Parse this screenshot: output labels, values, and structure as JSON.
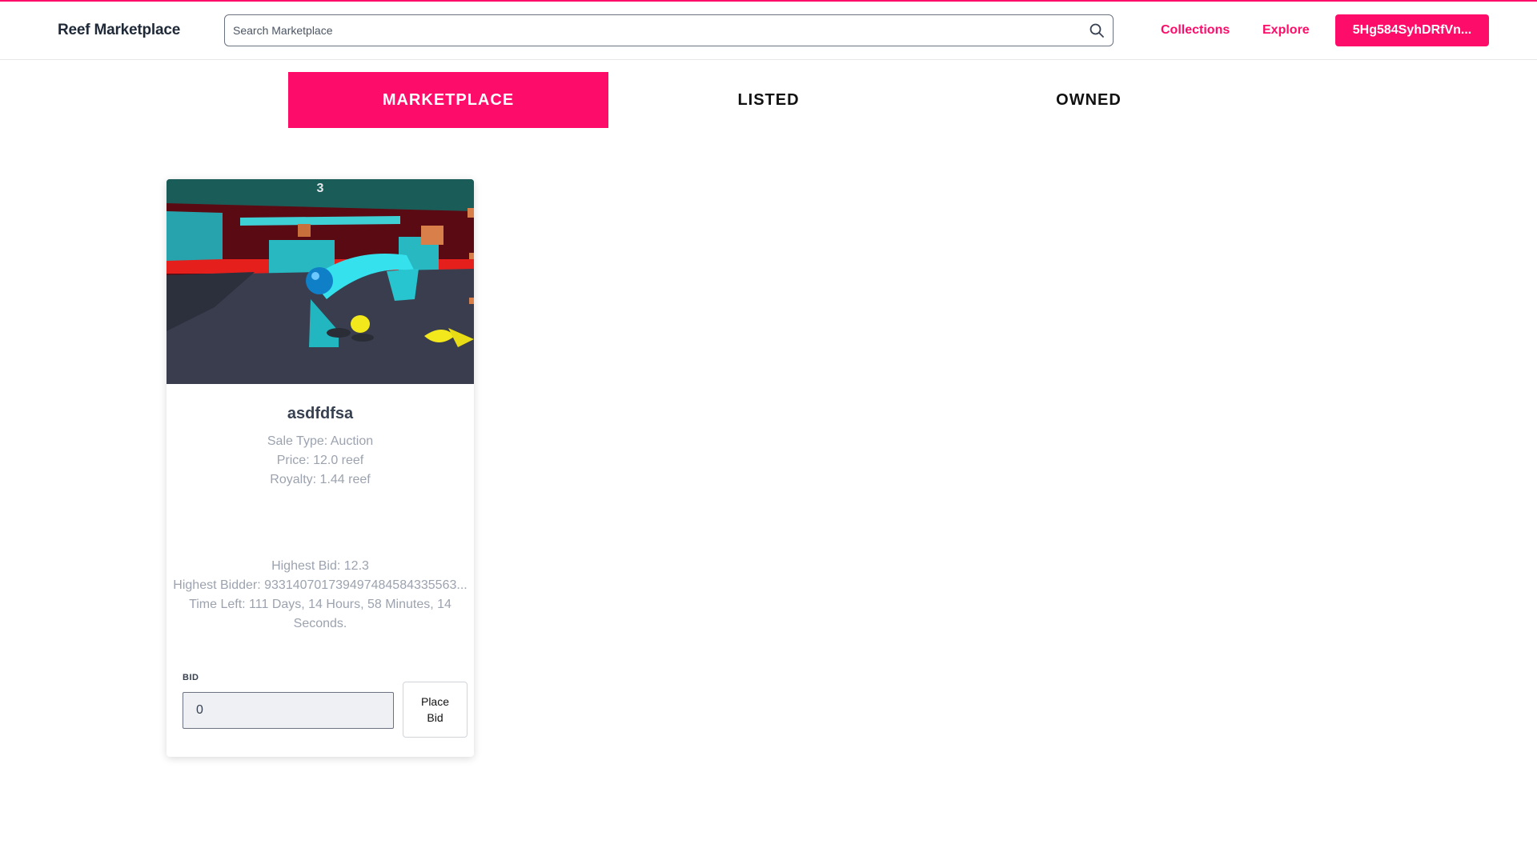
{
  "header": {
    "logo": "Reef Marketplace",
    "search_placeholder": "Search Marketplace",
    "search_icon": "search-icon",
    "links": {
      "collections": "Collections",
      "explore": "Explore"
    },
    "account_label": "5Hg584SyhDRfVn...",
    "accent_color": "#fd0c6a"
  },
  "tabs": [
    {
      "label": "MARKETPLACE",
      "active": true
    },
    {
      "label": "LISTED",
      "active": false
    },
    {
      "label": "OWNED",
      "active": false
    }
  ],
  "card": {
    "image_overlay_number": "3",
    "title": "asdfdfsa",
    "sale_type": "Sale Type: Auction",
    "price": "Price: 12.0 reef",
    "royalty": "Royalty: 1.44 reef",
    "highest_bid": "Highest Bid: 12.3",
    "highest_bidder": "Highest Bidder: 933140701739497484584335563...",
    "time_left": "Time Left: 111 Days, 14 Hours, 58 Minutes, 14 Seconds.",
    "bid_label": "BID",
    "bid_value": "0",
    "place_bid_label": "Place Bid"
  }
}
